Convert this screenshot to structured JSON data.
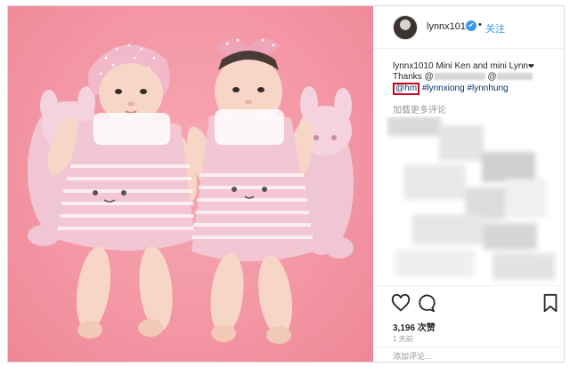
{
  "post": {
    "username": "lynnx1010",
    "verified_glyph": "✔",
    "separator": "•",
    "follow_label": "关注"
  },
  "caption": {
    "author": "lynnx1010",
    "text_1": "Mini Ken and mini Lynn",
    "emoji": "❤",
    "thanks_prefix": "Thanks @",
    "at_2": "@",
    "hm_tag": "@hm",
    "tag_1": "#lynnxiong",
    "tag_2": "#lynnhung"
  },
  "more_comments": "加载更多评论",
  "likes": "3,196 次赞",
  "time_ago": "1 天前",
  "add_comment_placeholder": "添加评论...",
  "icons": {
    "like": "heart-outline",
    "comment": "speech-bubble",
    "save": "bookmark",
    "verified": "verified-check"
  },
  "colors": {
    "background_photo": "#f497a5",
    "link_blue": "#3897f0",
    "hashtag_blue": "#003569",
    "highlight_red": "#d0021b"
  }
}
